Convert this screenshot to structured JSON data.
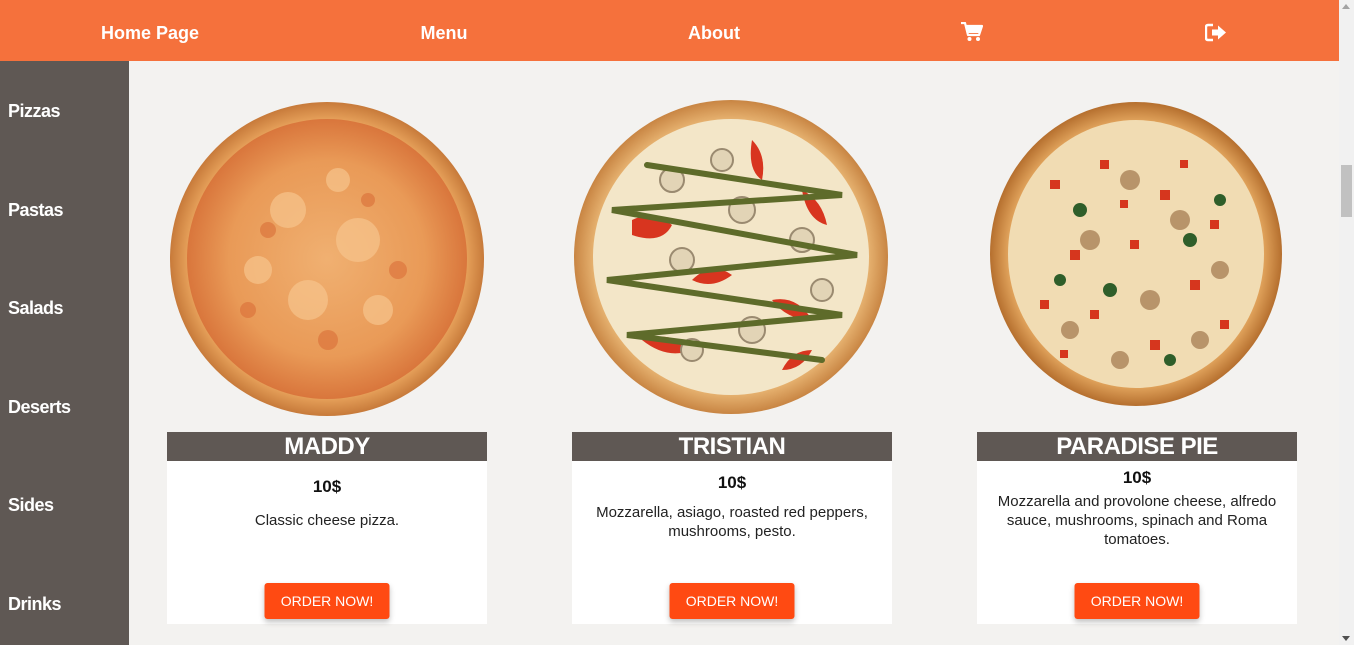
{
  "nav": {
    "home": "Home Page",
    "menu": "Menu",
    "about": "About",
    "cart_icon": "cart-icon",
    "logout_icon": "sign-out-icon"
  },
  "sidebar": {
    "items": [
      {
        "label": "Pizzas"
      },
      {
        "label": "Pastas"
      },
      {
        "label": "Salads"
      },
      {
        "label": "Deserts"
      },
      {
        "label": "Sides"
      },
      {
        "label": "Drinks"
      }
    ]
  },
  "products": [
    {
      "name": "MADDY",
      "price": "10$",
      "description": "Classic cheese pizza.",
      "button": "ORDER NOW!"
    },
    {
      "name": "TRISTIAN",
      "price": "10$",
      "description": "Mozzarella, asiago, roasted red peppers, mushrooms, pesto.",
      "button": "ORDER NOW!"
    },
    {
      "name": "PARADISE PIE",
      "price": "10$",
      "description": "Mozzarella and provolone cheese, alfredo sauce, mushrooms, spinach and Roma tomatoes.",
      "button": "ORDER NOW!"
    }
  ],
  "colors": {
    "nav_bg": "#f5713c",
    "sidebar_bg": "#5f5854",
    "button_bg": "#ff4a12",
    "page_bg": "#f3f2f0"
  }
}
